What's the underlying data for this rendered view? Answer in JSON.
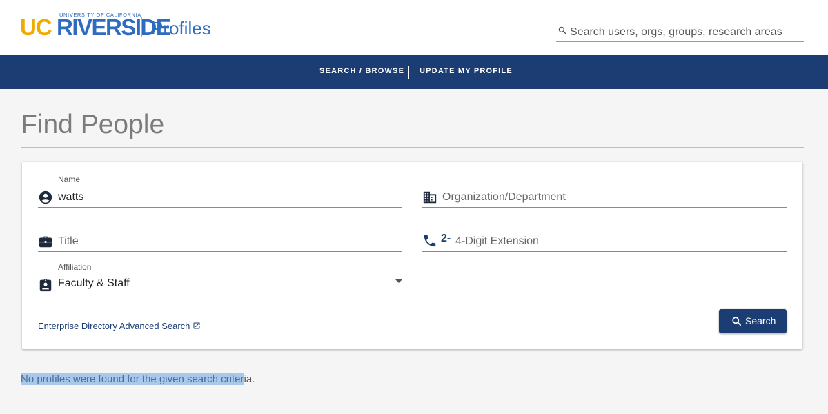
{
  "header": {
    "logo": {
      "uc": "UC",
      "riverside": "RIVERSIDE",
      "university": "UNIVERSITY OF CALIFORNIA",
      "app_name": "Profiles"
    },
    "search": {
      "placeholder": "Search users, orgs, groups, research areas",
      "value": ""
    }
  },
  "nav": {
    "items": [
      {
        "label": "SEARCH / BROWSE"
      },
      {
        "label": "UPDATE MY PROFILE"
      }
    ]
  },
  "page": {
    "title": "Find People"
  },
  "form": {
    "name": {
      "label": "Name",
      "value": "watts",
      "icon": "account-circle-icon"
    },
    "organization": {
      "placeholder": "Organization/Department",
      "value": "",
      "icon": "building-icon"
    },
    "title": {
      "placeholder": "Title",
      "value": "",
      "icon": "briefcase-icon"
    },
    "extension": {
      "prefix": "2-",
      "placeholder": "4-Digit Extension",
      "value": "",
      "icon": "phone-icon"
    },
    "affiliation": {
      "label": "Affiliation",
      "selected": "Faculty & Staff",
      "icon": "id-badge-icon"
    },
    "advanced_link": "Enterprise Directory Advanced Search",
    "search_button": "Search"
  },
  "results": {
    "message_highlighted": "No profiles were found for the given search criter",
    "message_rest": "ia."
  },
  "colors": {
    "brand_navy": "#1b3d74",
    "brand_blue": "#2d6cc0",
    "brand_gold": "#f1ab00",
    "selection": "#a9c9ec"
  }
}
